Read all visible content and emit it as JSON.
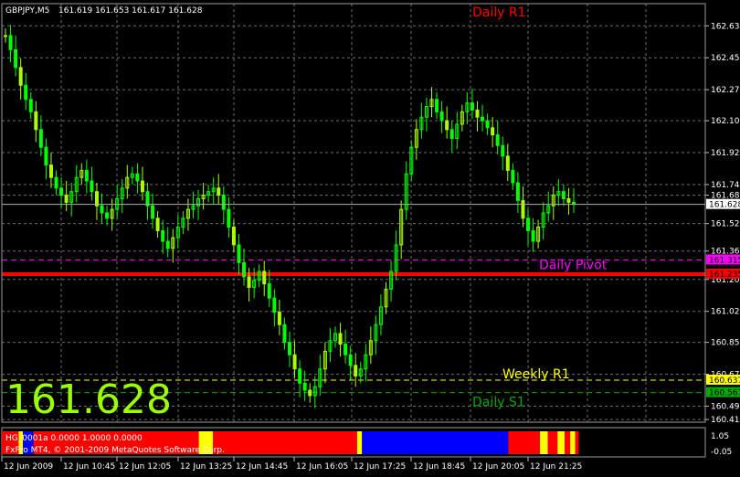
{
  "header": {
    "symbol": "GBPJPY,M5",
    "ohlc": "161.619 161.653 161.617 161.628"
  },
  "big_price": "161.628",
  "price_axis": {
    "ticks": [
      "162.635",
      "162.455",
      "162.275",
      "162.100",
      "161.920",
      "161.740",
      "161.680",
      "161.520",
      "161.365",
      "161.205",
      "161.025",
      "160.850",
      "160.670",
      "160.490",
      "160.415",
      "161.315",
      "161.235"
    ],
    "current": "161.628",
    "labels": [
      {
        "text": "162.635",
        "value": 162.635
      },
      {
        "text": "162.455",
        "value": 162.455
      },
      {
        "text": "162.275",
        "value": 162.275
      },
      {
        "text": "162.100",
        "value": 162.1
      },
      {
        "text": "161.920",
        "value": 161.92
      },
      {
        "text": "161.740",
        "value": 161.74
      },
      {
        "text": "161.680",
        "value": 161.68
      },
      {
        "text": "161.520",
        "value": 161.52
      },
      {
        "text": "161.365",
        "value": 161.365
      },
      {
        "text": "161.205",
        "value": 161.205
      },
      {
        "text": "161.025",
        "value": 161.025
      },
      {
        "text": "160.850",
        "value": 160.85
      },
      {
        "text": "160.670",
        "value": 160.67
      },
      {
        "text": "160.490",
        "value": 160.49
      },
      {
        "text": "160.415",
        "value": 160.415
      }
    ],
    "markers": [
      {
        "text": "161.628",
        "value": 161.628,
        "bg": "#ffffff",
        "fg": "#000000"
      },
      {
        "text": "161.315",
        "value": 161.315,
        "bg": "#ff00ff",
        "fg": "#000000"
      },
      {
        "text": "161.235",
        "value": 161.235,
        "bg": "#ff0000",
        "fg": "#000000"
      },
      {
        "text": "160.637",
        "value": 160.637,
        "bg": "#ffff00",
        "fg": "#000000"
      },
      {
        "text": "160.567",
        "value": 160.567,
        "bg": "#00aa00",
        "fg": "#000000"
      }
    ]
  },
  "levels": [
    {
      "name": "Daily R1",
      "value": 162.68,
      "color": "#ff0000",
      "style": "none"
    },
    {
      "name": "Daily Pivot",
      "value": 161.315,
      "color": "#ff00ff",
      "style": "dash"
    },
    {
      "name": "",
      "value": 161.235,
      "color": "#ff0000",
      "style": "thick"
    },
    {
      "name": "Weekly R1",
      "value": 160.637,
      "color": "#ffff00",
      "style": "dash"
    },
    {
      "name": "Daily S1",
      "value": 160.567,
      "color": "#00aa00",
      "style": "dash"
    }
  ],
  "indicator": {
    "label1": "HG_0001a 0.0000 1.0000 0.0000",
    "label2": "FxPro MT4, © 2001-2009 MetaQuotes Software Corp.",
    "axis_top": "1.05",
    "axis_bottom": "-0.05",
    "segments": [
      {
        "from": 0.0,
        "to": 0.024,
        "color": "#ff0000"
      },
      {
        "from": 0.024,
        "to": 0.03,
        "color": "#ffff00"
      },
      {
        "from": 0.03,
        "to": 0.045,
        "color": "#0000ff"
      },
      {
        "from": 0.045,
        "to": 0.28,
        "color": "#ff0000"
      },
      {
        "from": 0.28,
        "to": 0.3,
        "color": "#ffff00"
      },
      {
        "from": 0.3,
        "to": 0.505,
        "color": "#ff0000"
      },
      {
        "from": 0.505,
        "to": 0.512,
        "color": "#ffff00"
      },
      {
        "from": 0.512,
        "to": 0.72,
        "color": "#0000ff"
      },
      {
        "from": 0.72,
        "to": 0.765,
        "color": "#ff0000"
      },
      {
        "from": 0.765,
        "to": 0.776,
        "color": "#ffff00"
      },
      {
        "from": 0.776,
        "to": 0.79,
        "color": "#ff0000"
      },
      {
        "from": 0.79,
        "to": 0.8,
        "color": "#ffff00"
      },
      {
        "from": 0.8,
        "to": 0.808,
        "color": "#ff0000"
      },
      {
        "from": 0.808,
        "to": 0.815,
        "color": "#ffff00"
      },
      {
        "from": 0.815,
        "to": 0.82,
        "color": "#ff0000"
      }
    ]
  },
  "time_axis": [
    "12 Jun 2009",
    "12 Jun 10:45",
    "12 Jun 12:05",
    "12 Jun 13:25",
    "12 Jun 14:45",
    "12 Jun 16:05",
    "12 Jun 17:25",
    "12 Jun 18:45",
    "12 Jun 20:05",
    "12 Jun 21:25"
  ],
  "colors": {
    "bg": "#000000",
    "grid": "#6e6e6e",
    "candle": "#00ff00",
    "candle_alt": "#aaff00",
    "text": "#ffffff",
    "big_price": "#9cff00"
  },
  "price_series": [
    162.58,
    162.5,
    162.4,
    162.3,
    162.22,
    162.15,
    162.05,
    161.95,
    161.85,
    161.78,
    161.72,
    161.68,
    161.64,
    161.7,
    161.78,
    161.82,
    161.76,
    161.7,
    161.62,
    161.58,
    161.55,
    161.6,
    161.66,
    161.72,
    161.78,
    161.8,
    161.76,
    161.7,
    161.62,
    161.55,
    161.48,
    161.42,
    161.38,
    161.44,
    161.5,
    161.55,
    161.6,
    161.62,
    161.66,
    161.68,
    161.7,
    161.72,
    161.68,
    161.6,
    161.5,
    161.4,
    161.3,
    161.22,
    161.16,
    161.2,
    161.25,
    161.18,
    161.1,
    161.02,
    160.95,
    160.85,
    160.78,
    160.7,
    160.62,
    160.58,
    160.55,
    160.6,
    160.7,
    160.8,
    160.86,
    160.9,
    160.84,
    160.78,
    160.72,
    160.66,
    160.7,
    160.78,
    160.86,
    160.95,
    161.05,
    161.15,
    161.25,
    161.4,
    161.6,
    161.8,
    161.95,
    162.05,
    162.12,
    162.18,
    162.22,
    162.15,
    162.1,
    162.05,
    162.0,
    162.08,
    162.15,
    162.2,
    162.16,
    162.12,
    162.1,
    162.06,
    162.02,
    161.96,
    161.9,
    161.82,
    161.75,
    161.65,
    161.55,
    161.48,
    161.42,
    161.5,
    161.58,
    161.62,
    161.68,
    161.7,
    161.66,
    161.64,
    161.63
  ]
}
